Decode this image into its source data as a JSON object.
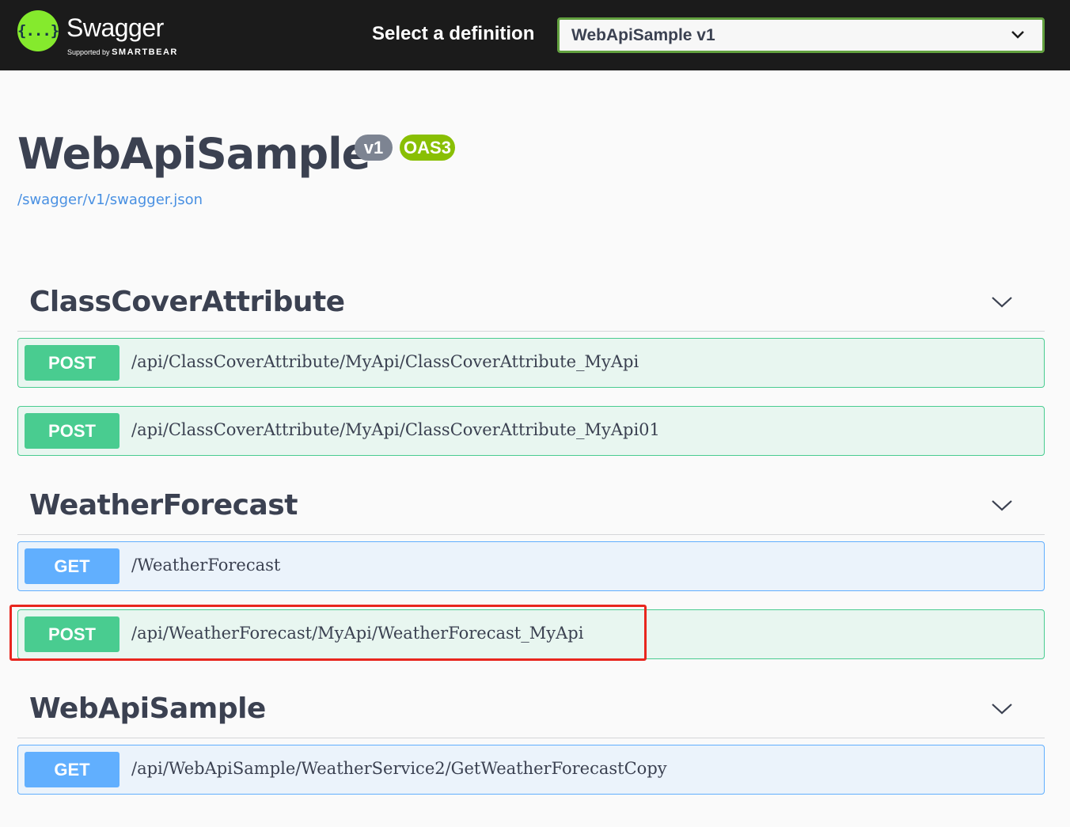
{
  "topbar": {
    "logo_glyph": "{...}",
    "brand_name": "Swagger",
    "brand_sub_prefix": "Supported by",
    "brand_sub_company": "SMARTBEAR",
    "definition_label": "Select a definition",
    "definition_selected": "WebApiSample v1"
  },
  "info": {
    "title": "WebApiSample",
    "version_badge": "v1",
    "oas_badge": "OAS3",
    "spec_url": "/swagger/v1/swagger.json"
  },
  "tags": [
    {
      "name": "ClassCoverAttribute",
      "operations": [
        {
          "method": "POST",
          "path": "/api/ClassCoverAttribute/MyApi/ClassCoverAttribute_MyApi"
        },
        {
          "method": "POST",
          "path": "/api/ClassCoverAttribute/MyApi/ClassCoverAttribute_MyApi01"
        }
      ]
    },
    {
      "name": "WeatherForecast",
      "operations": [
        {
          "method": "GET",
          "path": "/WeatherForecast"
        },
        {
          "method": "POST",
          "path": "/api/WeatherForecast/MyApi/WeatherForecast_MyApi"
        }
      ]
    },
    {
      "name": "WebApiSample",
      "operations": [
        {
          "method": "GET",
          "path": "/api/WebApiSample/WeatherService2/GetWeatherForecastCopy"
        }
      ]
    }
  ],
  "colors": {
    "post": "#49cc90",
    "get": "#61affe",
    "highlight": "#e8261e",
    "accent": "#85ea2d"
  }
}
